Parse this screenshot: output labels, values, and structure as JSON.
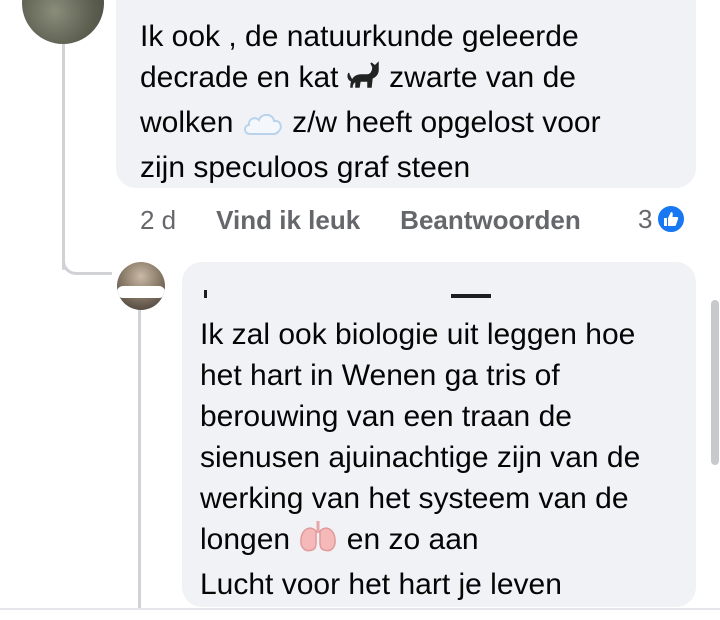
{
  "comment_1": {
    "text_line_1": "Ik ook , de natuurkunde geleerde",
    "text_line_2a": "decrade en kat",
    "text_line_2b": "zwarte van de",
    "text_line_3a": "wolken",
    "text_line_3b": "z/w heeft opgelost voor",
    "text_line_4": "zijn speculoos graf steen",
    "emoji_1": "black-cat-icon",
    "emoji_2": "cloud-icon",
    "timestamp": "2 d",
    "like_label": "Vind ik leuk",
    "reply_label": "Beantwoorden",
    "reaction_count": "3",
    "reaction_icon": "like-thumb-icon"
  },
  "comment_2": {
    "text_line_1": "Ik zal ook biologie uit leggen hoe",
    "text_line_2": "het hart in Wenen ga tris of",
    "text_line_3": "berouwing van een traan de",
    "text_line_4": "sienusen ajuinachtige zijn van de",
    "text_line_5": "werking van het systeem van de",
    "text_line_6a": "longen",
    "text_line_6b": "en zo aan",
    "text_line_7": "Lucht voor het hart je leven",
    "emoji_1": "lungs-icon"
  },
  "colors": {
    "bubble": "#f0f2f5",
    "action_text": "#65676b",
    "like_blue": "#1877f2",
    "thread_line": "#d0d2d6"
  }
}
